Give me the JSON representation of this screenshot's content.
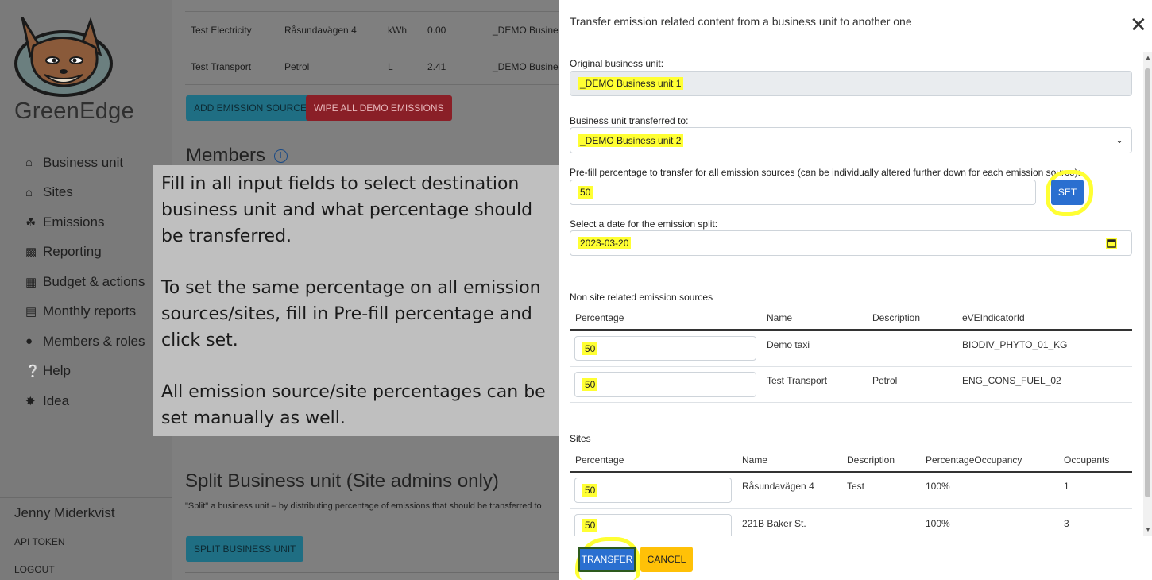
{
  "sidebar": {
    "brand": "GreenEdge",
    "items": [
      {
        "label": "Business unit",
        "icon": "home-icon"
      },
      {
        "label": "Sites",
        "icon": "house-icon"
      },
      {
        "label": "Emissions",
        "icon": "seedling-icon"
      },
      {
        "label": "Reporting",
        "icon": "chart-icon"
      },
      {
        "label": "Budget & actions",
        "icon": "calculator-icon"
      },
      {
        "label": "Monthly reports",
        "icon": "report-icon"
      },
      {
        "label": "Members & roles",
        "icon": "users-icon"
      },
      {
        "label": "Help",
        "icon": "question-icon"
      },
      {
        "label": "Idea",
        "icon": "lightbulb-icon"
      }
    ],
    "user_name": "Jenny Miderkvist",
    "api_token": "API TOKEN",
    "logout": "LOGOUT"
  },
  "main": {
    "rows": [
      {
        "name": "Test Electricity",
        "desc": "Råsundavägen 4",
        "unit": "kWh",
        "value": "0.00",
        "bu": "_DEMO Busines"
      },
      {
        "name": "Test Transport",
        "desc": "Petrol",
        "unit": "L",
        "value": "2.41",
        "bu": "_DEMO Busines"
      }
    ],
    "add_emission_source": "ADD EMISSION SOURCE",
    "wipe_demo": "WIPE ALL DEMO EMISSIONS",
    "members_title": "Members",
    "split_title": "Split Business unit (Site admins only)",
    "split_desc": "\"Split\" a business unit – by distributing percentage of emissions that should be transferred to",
    "split_button": "SPLIT BUSINESS UNIT"
  },
  "overlay": {
    "p1": "Fill in all input fields to select destination business unit and what percentage should be transferred.",
    "p2": "To set the same percentage on all emission sources/sites, fill in Pre-fill percentage and click set.",
    "p3": "All emission source/site percentages can be set manually as well."
  },
  "modal": {
    "title": "Transfer emission related content from a business unit to another one",
    "original_label": "Original business unit:",
    "original_value": "_DEMO Business unit 1",
    "target_label": "Business unit transferred to:",
    "target_value": "_DEMO Business unit 2",
    "prefill_label": "Pre-fill percentage to transfer for all emission sources (can be individually altered further down for each emission source):",
    "prefill_value": "50",
    "set_button": "SET",
    "date_label": "Select a date for the emission split:",
    "date_value": "2023-03-20",
    "nonsite_title": "Non site related emission sources",
    "nonsite_headers": [
      "Percentage",
      "Name",
      "Description",
      "eVEIndicatorId"
    ],
    "nonsite_rows": [
      {
        "pct": "50",
        "name": "Demo taxi",
        "desc": "",
        "id": "BIODIV_PHYTO_01_KG"
      },
      {
        "pct": "50",
        "name": "Test Transport",
        "desc": "Petrol",
        "id": "ENG_CONS_FUEL_02"
      }
    ],
    "sites_title": "Sites",
    "sites_headers": [
      "Percentage",
      "Name",
      "Description",
      "PercentageOccupancy",
      "Occupants"
    ],
    "sites_rows": [
      {
        "pct": "50",
        "name": "Råsundavägen 4",
        "desc": "Test",
        "occ_pct": "100%",
        "occupants": "1"
      },
      {
        "pct": "50",
        "name": "221B Baker St.",
        "desc": "",
        "occ_pct": "100%",
        "occupants": "3"
      }
    ],
    "transfer_button": "TRANSFER",
    "cancel_button": "CANCEL"
  },
  "colors": {
    "primary": "#2a6fd0",
    "danger": "#c0392b",
    "warning": "#ffc107",
    "highlight": "#ffff33"
  }
}
